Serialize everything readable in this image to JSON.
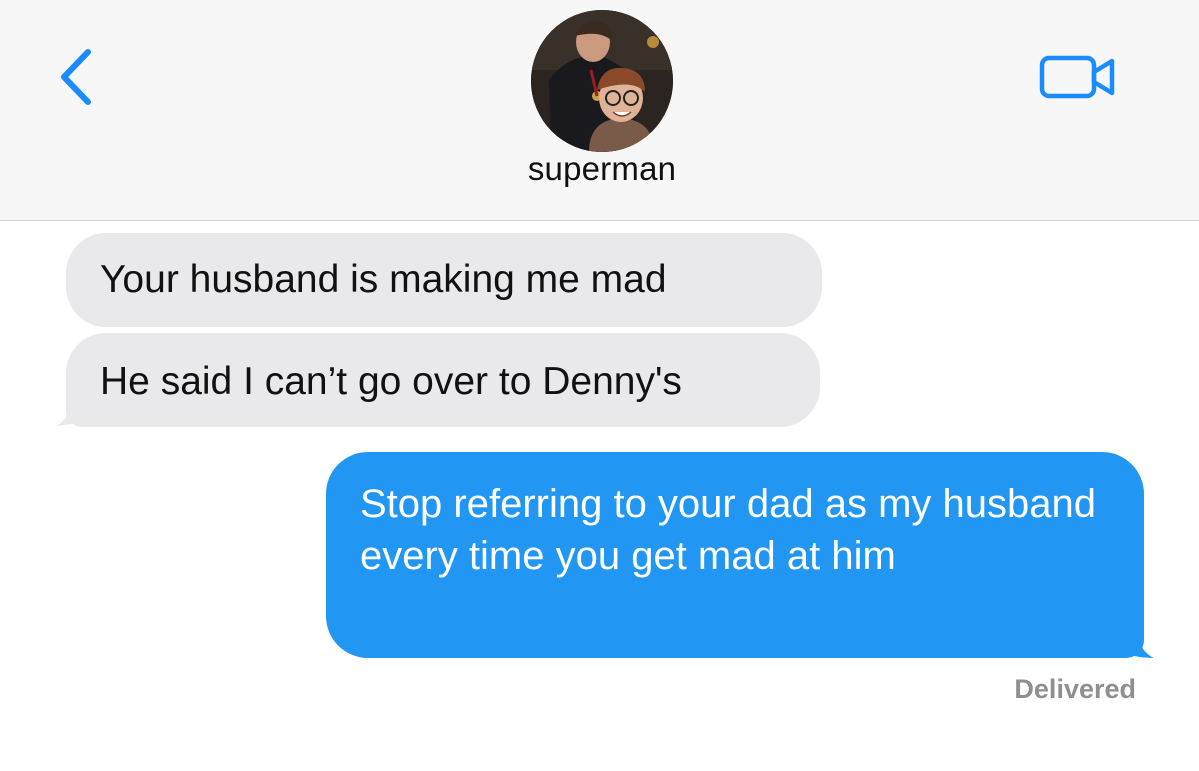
{
  "header": {
    "contact_name": "superman",
    "back_icon": "chevron-left-icon",
    "video_icon": "video-camera-icon"
  },
  "messages": [
    {
      "direction": "incoming",
      "text": "Your husband is making me mad"
    },
    {
      "direction": "incoming",
      "text": "He said I can’t go over to Denny's"
    },
    {
      "direction": "outgoing",
      "text": "Stop referring to your dad as my husband every time you get mad at him"
    }
  ],
  "status": {
    "delivered_label": "Delivered"
  },
  "colors": {
    "accent": "#1a8cff",
    "incoming_bubble": "#e9e9eb",
    "outgoing_bubble": "#2196f3",
    "header_background": "#f7f7f7"
  }
}
